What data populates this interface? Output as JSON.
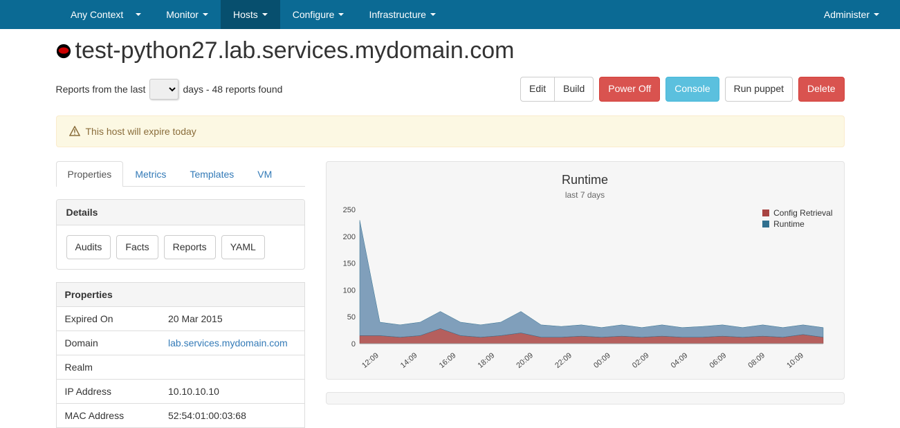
{
  "nav": {
    "context": "Any Context",
    "items": [
      "Monitor",
      "Hosts",
      "Configure",
      "Infrastructure"
    ],
    "active": "Hosts",
    "admin": "Administer"
  },
  "host": {
    "title": "test-python27.lab.services.mydomain.com"
  },
  "reports": {
    "prefix": "Reports from the last",
    "suffix": "days - 48 reports found"
  },
  "actions": {
    "edit": "Edit",
    "build": "Build",
    "power_off": "Power Off",
    "console": "Console",
    "run_puppet": "Run puppet",
    "delete": "Delete"
  },
  "alert": {
    "text": "This host will expire today"
  },
  "tabs": [
    "Properties",
    "Metrics",
    "Templates",
    "VM"
  ],
  "active_tab": "Properties",
  "details": {
    "heading": "Details",
    "buttons": [
      "Audits",
      "Facts",
      "Reports",
      "YAML"
    ]
  },
  "properties": {
    "heading": "Properties",
    "rows": [
      {
        "label": "Expired On",
        "value": "20 Mar 2015",
        "link": false
      },
      {
        "label": "Domain",
        "value": "lab.services.mydomain.com",
        "link": true
      },
      {
        "label": "Realm",
        "value": "",
        "link": false
      },
      {
        "label": "IP Address",
        "value": "10.10.10.10",
        "link": false
      },
      {
        "label": "MAC Address",
        "value": "52:54:01:00:03:68",
        "link": false
      }
    ]
  },
  "chart": {
    "title": "Runtime",
    "subtitle": "last 7 days",
    "legend": {
      "config_retrieval": {
        "label": "Config Retrieval",
        "color": "#a94442"
      },
      "runtime": {
        "label": "Runtime",
        "color": "#31708f"
      }
    }
  },
  "chart_data": {
    "type": "area",
    "title": "Runtime",
    "subtitle": "last 7 days",
    "xlabel": "",
    "ylabel": "",
    "ylim": [
      0,
      250
    ],
    "yticks": [
      0,
      50,
      100,
      150,
      200,
      250
    ],
    "categories": [
      "12:09",
      "14:09",
      "16:09",
      "18:09",
      "20:09",
      "22:09",
      "00:09",
      "02:09",
      "04:09",
      "06:09",
      "08:09",
      "10:09"
    ],
    "series": [
      {
        "name": "Runtime",
        "color": "#6b8fb0",
        "values": [
          230,
          40,
          35,
          40,
          60,
          40,
          35,
          40,
          60,
          35,
          32,
          35,
          30,
          35,
          30,
          35,
          30,
          32,
          35,
          30,
          35,
          30,
          35,
          30
        ]
      },
      {
        "name": "Config Retrieval",
        "color": "#a94442",
        "values": [
          15,
          15,
          12,
          15,
          28,
          15,
          12,
          15,
          20,
          12,
          12,
          14,
          12,
          14,
          12,
          14,
          12,
          12,
          14,
          12,
          14,
          12,
          17,
          12
        ]
      }
    ]
  }
}
